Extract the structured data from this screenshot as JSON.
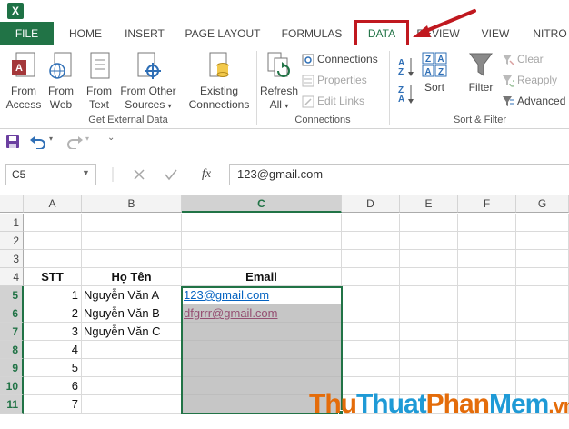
{
  "ribbon_tabs": [
    "FILE",
    "HOME",
    "INSERT",
    "PAGE LAYOUT",
    "FORMULAS",
    "DATA",
    "REVIEW",
    "VIEW",
    "NITRO"
  ],
  "ribbon": {
    "get_external": {
      "from_access": [
        "From",
        "Access"
      ],
      "from_web": [
        "From",
        "Web"
      ],
      "from_text": [
        "From",
        "Text"
      ],
      "from_other": [
        "From Other",
        "Sources"
      ],
      "existing": [
        "Existing",
        "Connections"
      ],
      "label": "Get External Data"
    },
    "connections": {
      "refresh": [
        "Refresh",
        "All"
      ],
      "connections": "Connections",
      "properties": "Properties",
      "edit_links": "Edit Links",
      "label": "Connections"
    },
    "sort_filter": {
      "sort": "Sort",
      "filter": "Filter",
      "clear": "Clear",
      "reapply": "Reapply",
      "advanced": "Advanced",
      "label": "Sort & Filter"
    }
  },
  "formula_bar": {
    "name_box": "C5",
    "fx": "fx",
    "value": "123@gmail.com"
  },
  "grid": {
    "columns": [
      "A",
      "B",
      "C",
      "D",
      "E",
      "F",
      "G"
    ],
    "rows": [
      "1",
      "2",
      "3",
      "4",
      "5",
      "6",
      "7",
      "8",
      "9",
      "10",
      "11"
    ],
    "header_row": {
      "stt": "STT",
      "ho_ten": "Họ Tên",
      "email": "Email"
    },
    "data": [
      {
        "stt": "1",
        "name": "Nguyễn Văn A",
        "email": "123@gmail.com"
      },
      {
        "stt": "2",
        "name": "Nguyễn Văn B",
        "email": "dfgrrr@gmail.com"
      },
      {
        "stt": "3",
        "name": "Nguyễn Văn C",
        "email": ""
      },
      {
        "stt": "4",
        "name": "",
        "email": ""
      },
      {
        "stt": "5",
        "name": "",
        "email": ""
      },
      {
        "stt": "6",
        "name": "",
        "email": ""
      },
      {
        "stt": "7",
        "name": "",
        "email": ""
      }
    ]
  },
  "watermark": {
    "thu": "Thu",
    "thuat": "Thuat",
    "phan": "Phan",
    "mem": "Mem",
    "vn": ".vn"
  },
  "colors": {
    "excel_green": "#217346",
    "highlight_red": "#c0181f",
    "link": "#0563c1",
    "visited": "#954f72"
  }
}
